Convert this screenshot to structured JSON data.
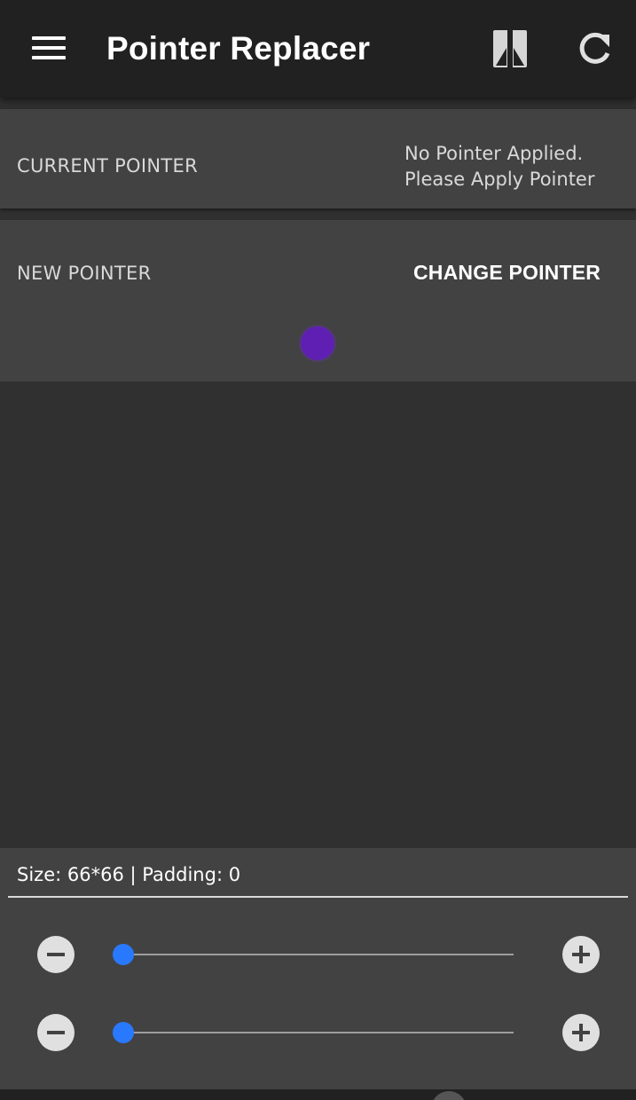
{
  "app_bar": {
    "title": "Pointer Replacer",
    "icons": [
      "menu-icon",
      "compare-icon",
      "refresh-icon"
    ]
  },
  "current_pointer": {
    "label": "CURRENT POINTER",
    "status_line1": "No Pointer Applied.",
    "status_line2": "Please Apply Pointer"
  },
  "new_pointer": {
    "label": "NEW POINTER",
    "change_button": "CHANGE POINTER",
    "preview_color": "#5f1fb3"
  },
  "controls": {
    "size_info": "Size: 66*66 | Padding: 0",
    "size_slider": {
      "value_fraction": 0.0
    },
    "padding_slider": {
      "value_fraction": 0.0
    },
    "accent_color": "#2979ff",
    "icons": [
      "minus-icon",
      "plus-icon"
    ]
  },
  "colors": {
    "background": "#303030",
    "app_bar": "#212121",
    "card": "#424242"
  }
}
